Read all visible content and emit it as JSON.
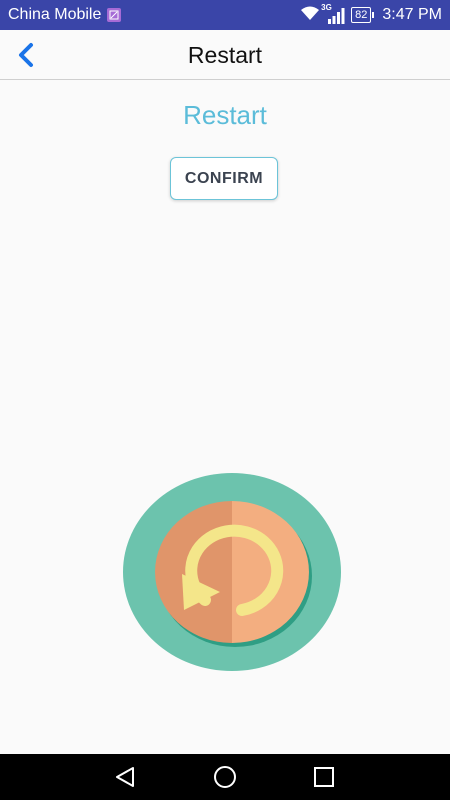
{
  "status_bar": {
    "carrier": "China Mobile",
    "network": "3G",
    "battery": "82",
    "time": "3:47 PM"
  },
  "header": {
    "title": "Restart",
    "back_icon": "chevron-left-icon"
  },
  "main": {
    "heading": "Restart",
    "confirm_label": "CONFIRM",
    "graphic_icon": "restart-icon"
  },
  "nav_bar": {
    "back_icon": "triangle-back-icon",
    "home_icon": "circle-home-icon",
    "recents_icon": "square-recents-icon"
  },
  "colors": {
    "status_bar": "#3a45a8",
    "accent": "#5bbcd9",
    "back_arrow": "#1a73e8",
    "graphic_outer": "#6cc3ad",
    "graphic_inner_left": "#e0956a",
    "graphic_inner_right": "#f3ae80",
    "graphic_arrow": "#f4e68a"
  }
}
